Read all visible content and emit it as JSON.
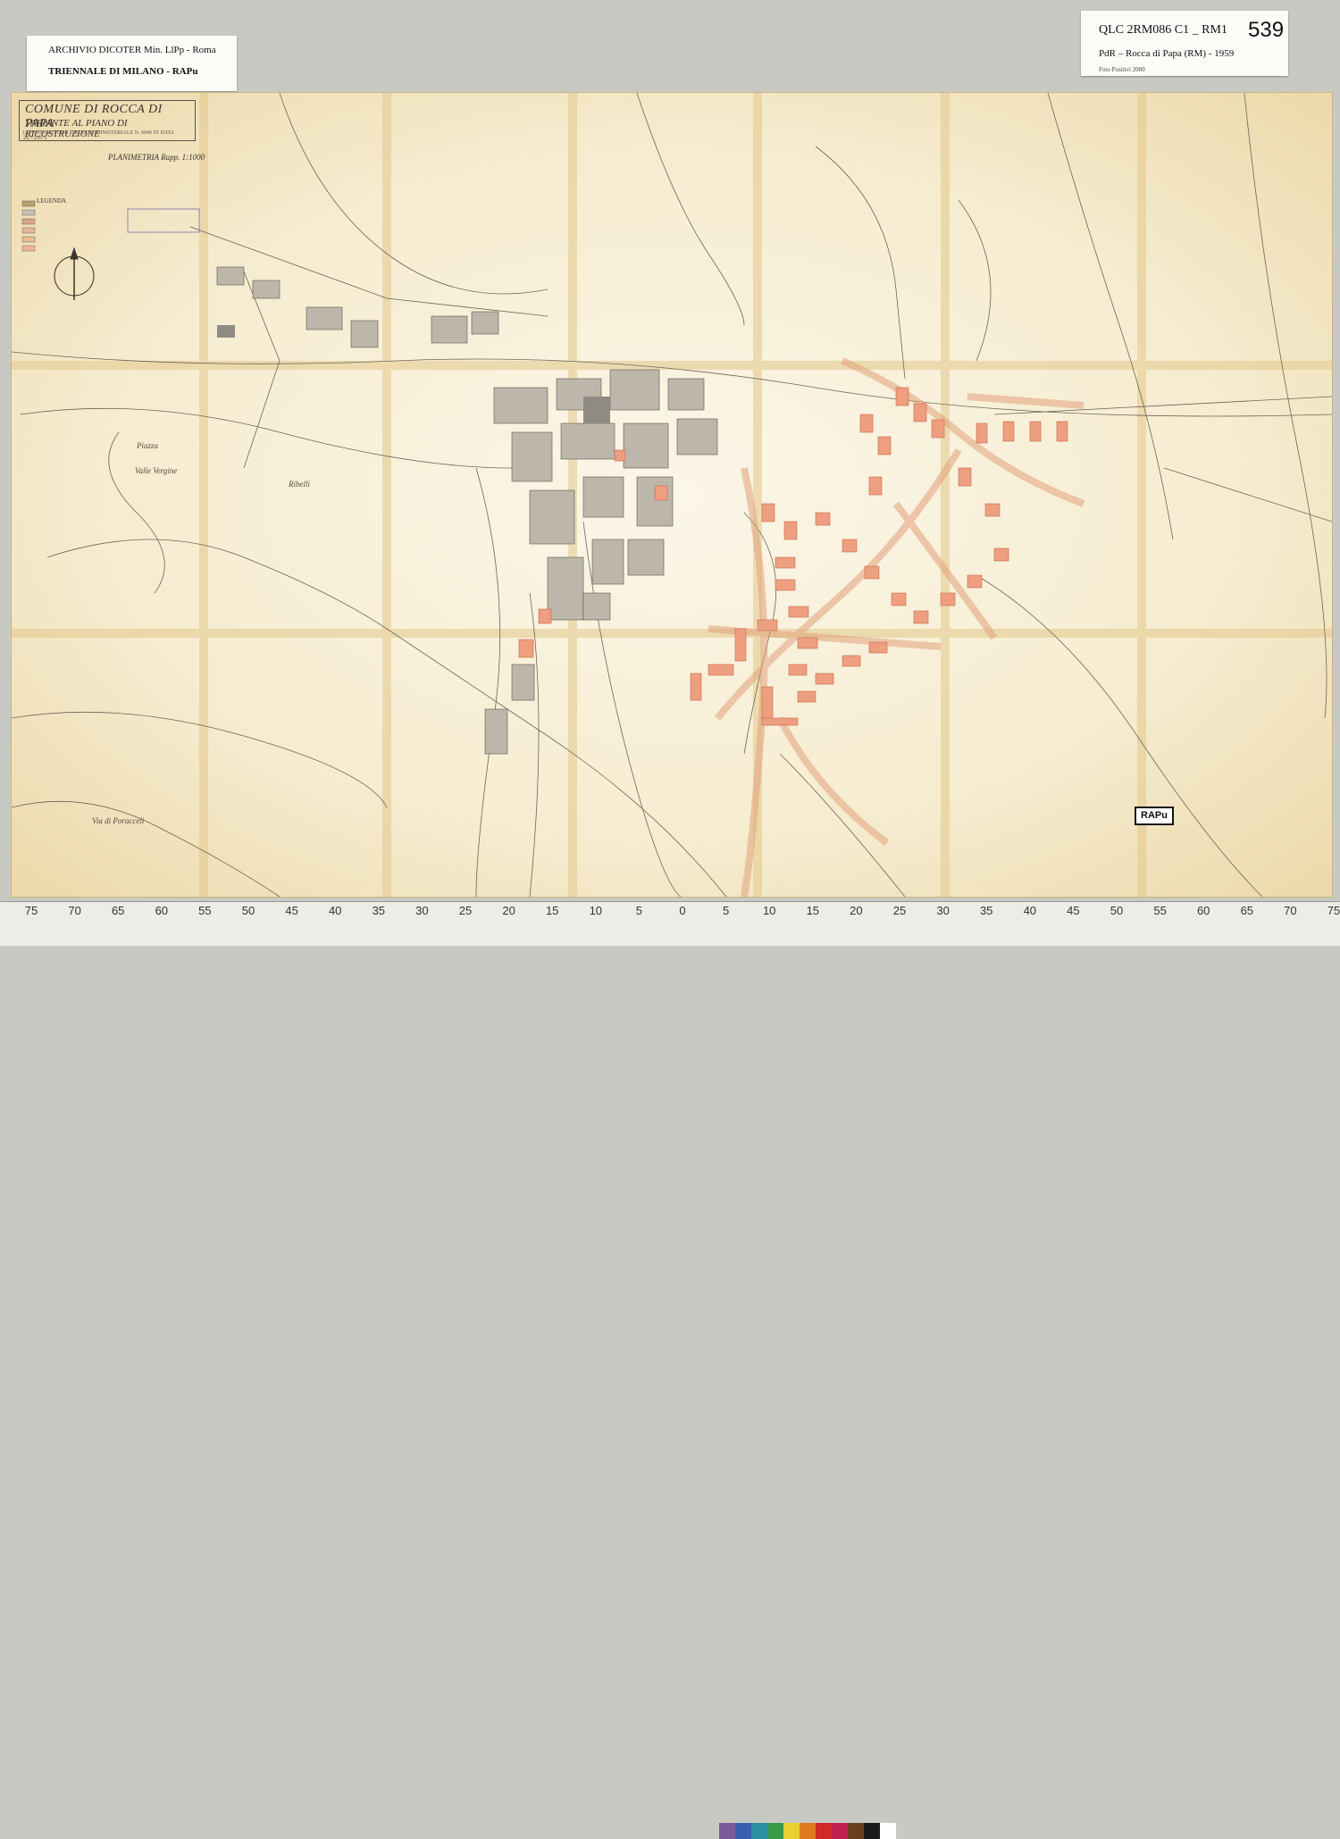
{
  "archive_card": {
    "line1": "ARCHIVIO DICOTER Min. LlPp - Roma",
    "line2": "TRIENNALE DI MILANO - RAPu"
  },
  "id_card": {
    "code": "QLC 2RM086 C1 _ RM1",
    "number": "539",
    "subtitle": "PdR – Rocca di Papa (RM) - 1959",
    "photo_credit": "Foto Positivi 2000"
  },
  "map": {
    "title_line1": "COMUNE DI ROCCA DI PAPA",
    "title_line2": "VARIANTE AL PIANO DI RICOSTRUZIONE",
    "title_line3": "(APPROVATO CON DECRETO MINISTERIALE N. 6040 IN DATA 26.7.1957)",
    "scale": "PLANIMETRIA Rapp. 1:1000",
    "legend_title": "LEGENDA",
    "legend_colors": [
      "#b7a06a",
      "#c9c0b4",
      "#d8a48e",
      "#e6b6a0",
      "#e8c090",
      "#f0b49a"
    ],
    "place_labels": {
      "piazza": "Piazza",
      "valle_vergine": "Valle Vergine",
      "ribelli": "Ribelli",
      "via_poracceli": "Via di Poracceli"
    },
    "badge": "RAPu"
  },
  "ruler": {
    "labels": [
      "75",
      "70",
      "65",
      "60",
      "55",
      "50",
      "45",
      "40",
      "35",
      "30",
      "25",
      "20",
      "15",
      "10",
      "5",
      "0",
      "5",
      "10",
      "15",
      "20",
      "25",
      "30",
      "35",
      "40",
      "45",
      "50",
      "55",
      "60",
      "65",
      "70",
      "75"
    ],
    "colors": [
      "#7a5a9a",
      "#3a5fb0",
      "#2a8fa0",
      "#3a9a4a",
      "#e8d030",
      "#e07a20",
      "#d02a2a",
      "#c02050",
      "#6a4020",
      "#1a1a1a",
      "#ffffff"
    ]
  }
}
